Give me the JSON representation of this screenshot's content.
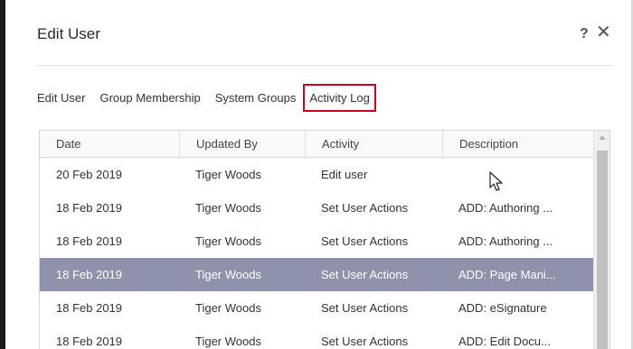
{
  "dialog": {
    "title": "Edit User",
    "help_symbol": "?",
    "close_symbol": "✕"
  },
  "tabs": [
    {
      "label": "Edit User",
      "active": false
    },
    {
      "label": "Group Membership",
      "active": false
    },
    {
      "label": "System Groups",
      "active": false
    },
    {
      "label": "Activity Log",
      "active": true
    }
  ],
  "grid": {
    "columns": [
      "Date",
      "Updated By",
      "Activity",
      "Description"
    ],
    "rows": [
      {
        "date": "20 Feb 2019",
        "updated_by": "Tiger Woods",
        "activity": "Edit user",
        "description": "",
        "selected": false
      },
      {
        "date": "18 Feb 2019",
        "updated_by": "Tiger Woods",
        "activity": "Set User Actions",
        "description": "ADD: Authoring ...",
        "selected": false
      },
      {
        "date": "18 Feb 2019",
        "updated_by": "Tiger Woods",
        "activity": "Set User Actions",
        "description": "ADD: Authoring ...",
        "selected": false
      },
      {
        "date": "18 Feb 2019",
        "updated_by": "Tiger Woods",
        "activity": "Set User Actions",
        "description": "ADD: Page Mani...",
        "selected": true
      },
      {
        "date": "18 Feb 2019",
        "updated_by": "Tiger Woods",
        "activity": "Set User Actions",
        "description": "ADD: eSignature",
        "selected": false
      },
      {
        "date": "18 Feb 2019",
        "updated_by": "Tiger Woods",
        "activity": "Set User Actions",
        "description": "ADD: Edit Docu...",
        "selected": false
      }
    ]
  },
  "colors": {
    "selected_row": "#8e93ab",
    "active_tab_outline": "#d0021b"
  },
  "icons": [
    "help-icon",
    "close-icon",
    "scroll-up-icon",
    "mouse-cursor-icon"
  ]
}
